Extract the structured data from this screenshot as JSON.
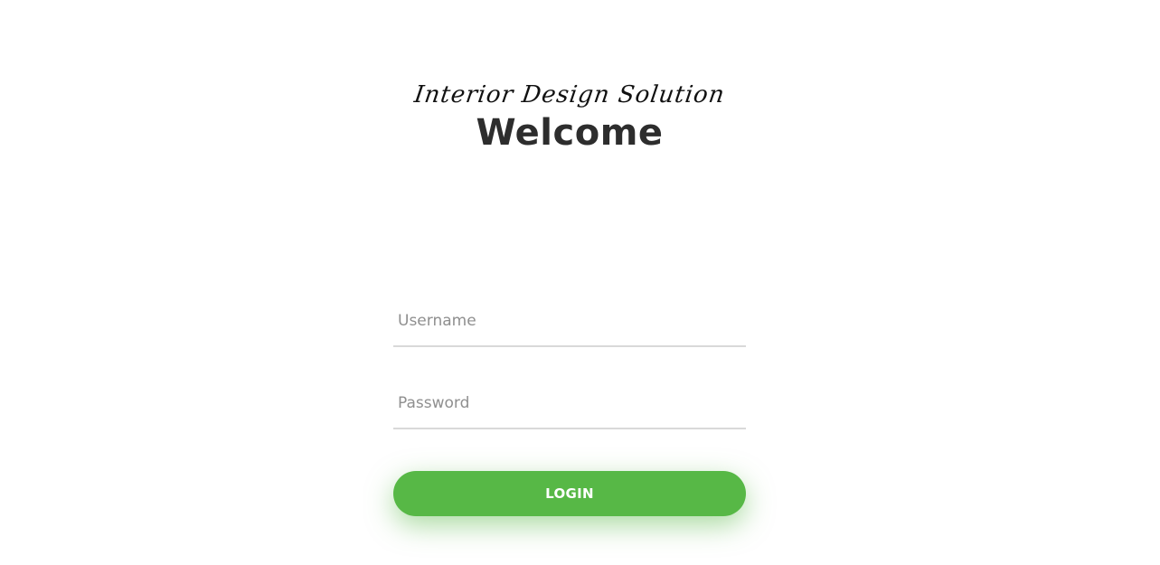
{
  "header": {
    "tagline": "Interior Design Solution",
    "title": "Welcome"
  },
  "form": {
    "username": {
      "value": "",
      "placeholder": "Username"
    },
    "password": {
      "value": "",
      "placeholder": "Password"
    },
    "submit_label": "LOGIN"
  },
  "colors": {
    "accent": "#57b846",
    "title": "#2d2d2d",
    "underline": "#d9d9d9",
    "placeholder": "#8f8f8f"
  }
}
